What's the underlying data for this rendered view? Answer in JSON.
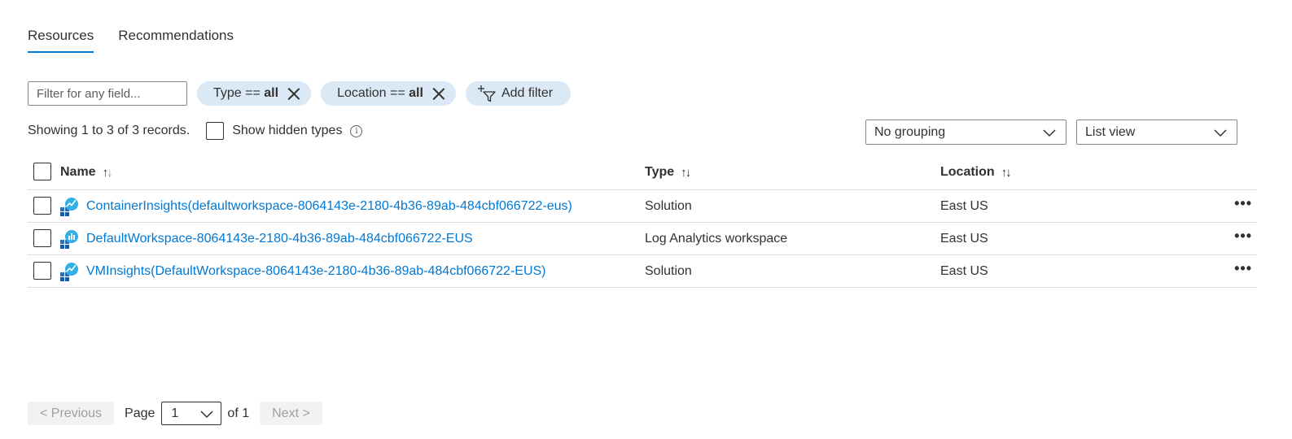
{
  "tabs": [
    {
      "label": "Resources",
      "active": true
    },
    {
      "label": "Recommendations",
      "active": false
    }
  ],
  "filter": {
    "placeholder": "Filter for any field...",
    "pills": [
      {
        "key": "Type == ",
        "value": "all"
      },
      {
        "key": "Location == ",
        "value": "all"
      }
    ],
    "add_filter_label": "Add filter"
  },
  "summary": {
    "records_text": "Showing 1 to 3 of 3 records.",
    "show_hidden_label": "Show hidden types",
    "info_glyph": "i"
  },
  "controls": {
    "grouping": "No grouping",
    "view": "List view"
  },
  "table": {
    "columns": {
      "name": "Name",
      "type": "Type",
      "location": "Location"
    },
    "rows": [
      {
        "name": "ContainerInsights(defaultworkspace-8064143e-2180-4b36-89ab-484cbf066722-eus)",
        "type": "Solution",
        "location": "East US",
        "icon": "solution-icon"
      },
      {
        "name": "DefaultWorkspace-8064143e-2180-4b36-89ab-484cbf066722-EUS",
        "type": "Log Analytics workspace",
        "location": "East US",
        "icon": "log-analytics-icon"
      },
      {
        "name": "VMInsights(DefaultWorkspace-8064143e-2180-4b36-89ab-484cbf066722-EUS)",
        "type": "Solution",
        "location": "East US",
        "icon": "solution-icon"
      }
    ],
    "more_glyph": "•••"
  },
  "pager": {
    "previous": "< Previous",
    "page_label": "Page",
    "page_value": "1",
    "of_label": "of 1",
    "next": "Next >"
  },
  "colors": {
    "accent": "#0078d4",
    "pill_bg": "#dbe9f7",
    "text": "#323130"
  }
}
